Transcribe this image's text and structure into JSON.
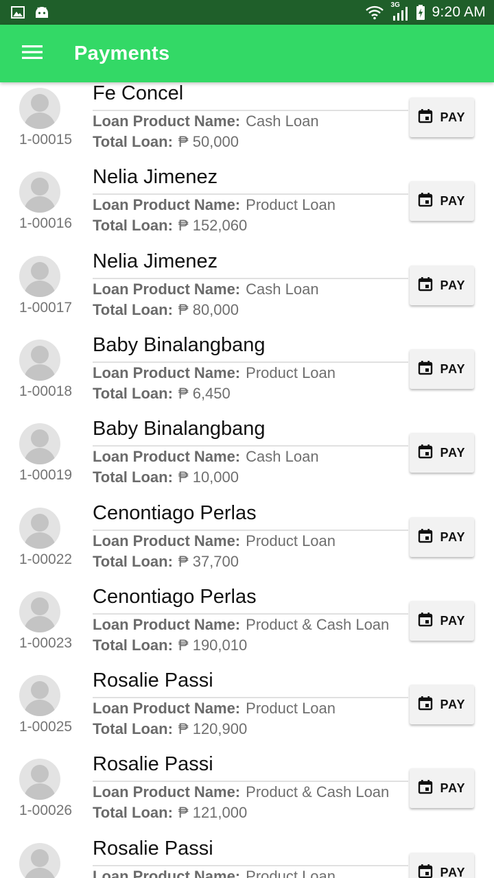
{
  "status_bar": {
    "time": "9:20 AM",
    "left_icons": [
      "gallery-icon",
      "android-icon"
    ],
    "right_icons": [
      "wifi-icon",
      "signal-3g-icon",
      "battery-charging-icon"
    ],
    "network_label": "3G"
  },
  "app_bar": {
    "title": "Payments",
    "menu_icon": "hamburger-menu-icon",
    "color": "#33d966"
  },
  "labels": {
    "loan_product_name": "Loan Product Name:",
    "total_loan": "Total Loan:",
    "pay_button": "PAY",
    "pay_icon": "calendar-icon"
  },
  "loans": [
    {
      "account": "1-00015",
      "name": "Fe Concel",
      "product": "Cash Loan",
      "total": "₱ 50,000"
    },
    {
      "account": "1-00016",
      "name": "Nelia Jimenez",
      "product": "Product Loan",
      "total": "₱ 152,060"
    },
    {
      "account": "1-00017",
      "name": "Nelia Jimenez",
      "product": "Cash Loan",
      "total": "₱ 80,000"
    },
    {
      "account": "1-00018",
      "name": "Baby Binalangbang",
      "product": "Product Loan",
      "total": "₱ 6,450"
    },
    {
      "account": "1-00019",
      "name": "Baby Binalangbang",
      "product": "Cash Loan",
      "total": "₱ 10,000"
    },
    {
      "account": "1-00022",
      "name": "Cenontiago Perlas",
      "product": "Product Loan",
      "total": "₱ 37,700"
    },
    {
      "account": "1-00023",
      "name": "Cenontiago Perlas",
      "product": "Product & Cash Loan",
      "total": "₱ 190,010"
    },
    {
      "account": "1-00025",
      "name": "Rosalie Passi",
      "product": "Product Loan",
      "total": "₱ 120,900"
    },
    {
      "account": "1-00026",
      "name": "Rosalie Passi",
      "product": "Product & Cash Loan",
      "total": "₱ 121,000"
    },
    {
      "account": "",
      "name": "Rosalie Passi",
      "product": "Product Loan",
      "total": ""
    }
  ]
}
